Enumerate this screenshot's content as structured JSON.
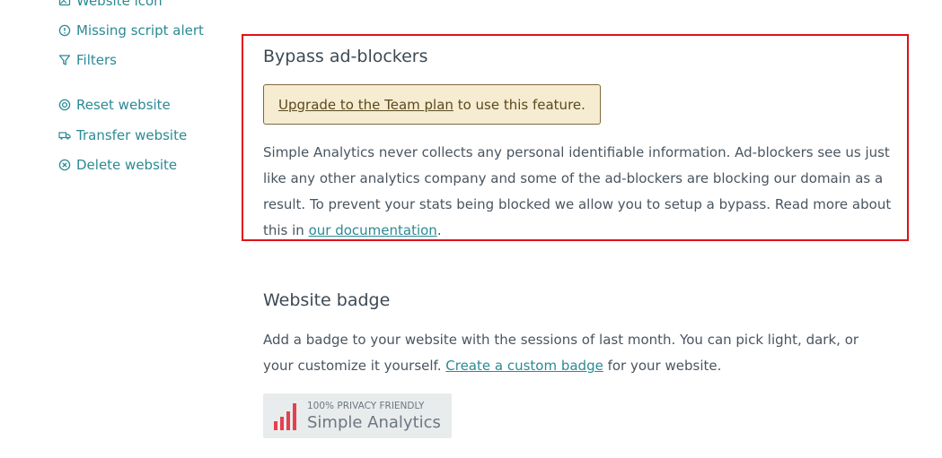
{
  "sidebar": {
    "items": [
      {
        "label": "Website icon",
        "icon": "image-icon"
      },
      {
        "label": "Missing script alert",
        "icon": "alert-circle-icon"
      },
      {
        "label": "Filters",
        "icon": "filter-icon"
      },
      {
        "label": "Reset website",
        "icon": "reset-icon"
      },
      {
        "label": "Transfer website",
        "icon": "truck-icon"
      },
      {
        "label": "Delete website",
        "icon": "close-circle-icon"
      }
    ]
  },
  "bypass": {
    "title": "Bypass ad-blockers",
    "upgrade_link": "Upgrade to the Team plan",
    "upgrade_rest": " to use this feature.",
    "desc": "Simple Analytics never collects any personal identifiable information. Ad-blockers see us just like any other analytics company and some of the ad-blockers are blocking our domain as a result. To prevent your stats being blocked we allow you to setup a bypass. Read more about this in ",
    "doc_link": "our documentation",
    "desc_end": "."
  },
  "badge_section": {
    "title": "Website badge",
    "desc": "Add a badge to your website with the sessions of last month. You can pick light, dark, or your customize it yourself. ",
    "custom_link": "Create a custom badge",
    "desc_end": " for your website.",
    "badge_top": "100% PRIVACY FRIENDLY",
    "badge_name": "Simple Analytics"
  },
  "colors": {
    "accent": "#2b8a94",
    "highlight_border": "#e0101a",
    "upgrade_bg": "#f6ecd2",
    "badge_bars": "#e5404f"
  }
}
